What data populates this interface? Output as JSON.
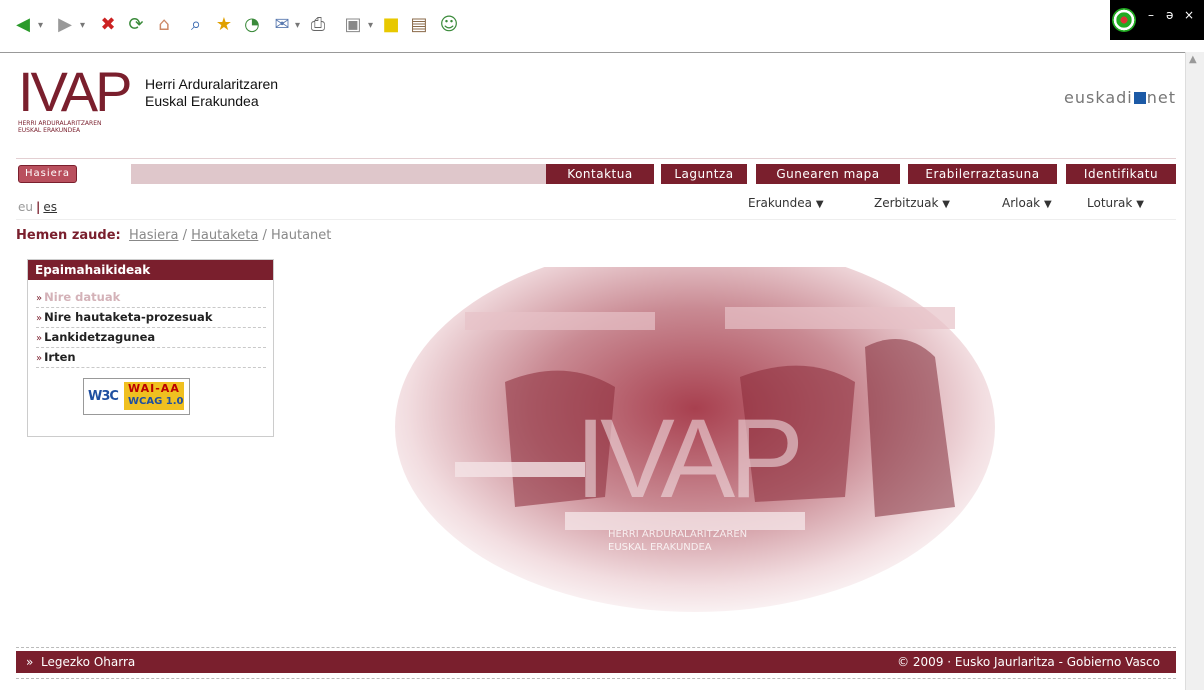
{
  "browser": {
    "toolbar_icons": [
      "back-icon",
      "forward-icon",
      "stop-icon",
      "refresh-icon",
      "home-icon",
      "search-icon",
      "favorites-icon",
      "history-icon",
      "mail-icon",
      "print-icon",
      "edit-icon",
      "notes-icon",
      "research-icon",
      "messenger-icon"
    ],
    "window_controls": {
      "minimize": "–",
      "restore": "ǝ",
      "close": "×"
    }
  },
  "header": {
    "logo_text": "IVAP",
    "logo_subtitle_1": "HERRI ARDURALARITZAREN",
    "logo_subtitle_2": "EUSKAL ERAKUNDEA",
    "org_name_1": "Herri Arduralaritzaren",
    "org_name_2": "Euskal Erakundea",
    "euskadi_left": "euskadi",
    "euskadi_right": "net"
  },
  "topnav": {
    "home": "Hasiera",
    "tabs": [
      "Kontaktua",
      "Laguntza",
      "Gunearen mapa",
      "Erabilerraztasuna",
      "Identifikatu"
    ]
  },
  "languages": {
    "current": "eu",
    "other": "es"
  },
  "menus": [
    "Erakundea",
    "Zerbitzuak",
    "Arloak",
    "Loturak"
  ],
  "breadcrumb": {
    "label": "Hemen zaude:",
    "links": [
      "Hasiera",
      "Hautaketa"
    ],
    "current": "Hautanet",
    "separator": "/"
  },
  "sidebar": {
    "title": "Epaimahaikideak",
    "items": [
      {
        "label": "Nire datuak",
        "disabled": true
      },
      {
        "label": "Nire hautaketa-prozesuak"
      },
      {
        "label": "Lankidetzagunea"
      },
      {
        "label": "Irten"
      }
    ],
    "wai_badge": {
      "w3c": "W3C",
      "level": "WAI-AA",
      "standard": "WCAG 1.0"
    }
  },
  "hero": {
    "logo_text": "IVAP",
    "sub_1": "HERRI ARDURALARITZAREN",
    "sub_2": "EUSKAL ERAKUNDEA"
  },
  "footer": {
    "legal": "Legezko Oharra",
    "copyright": "© 2009 · Eusko Jaurlaritza - Gobierno Vasco"
  },
  "colors": {
    "brand": "#7a1f2d",
    "brand_light": "#dfc7cb"
  }
}
